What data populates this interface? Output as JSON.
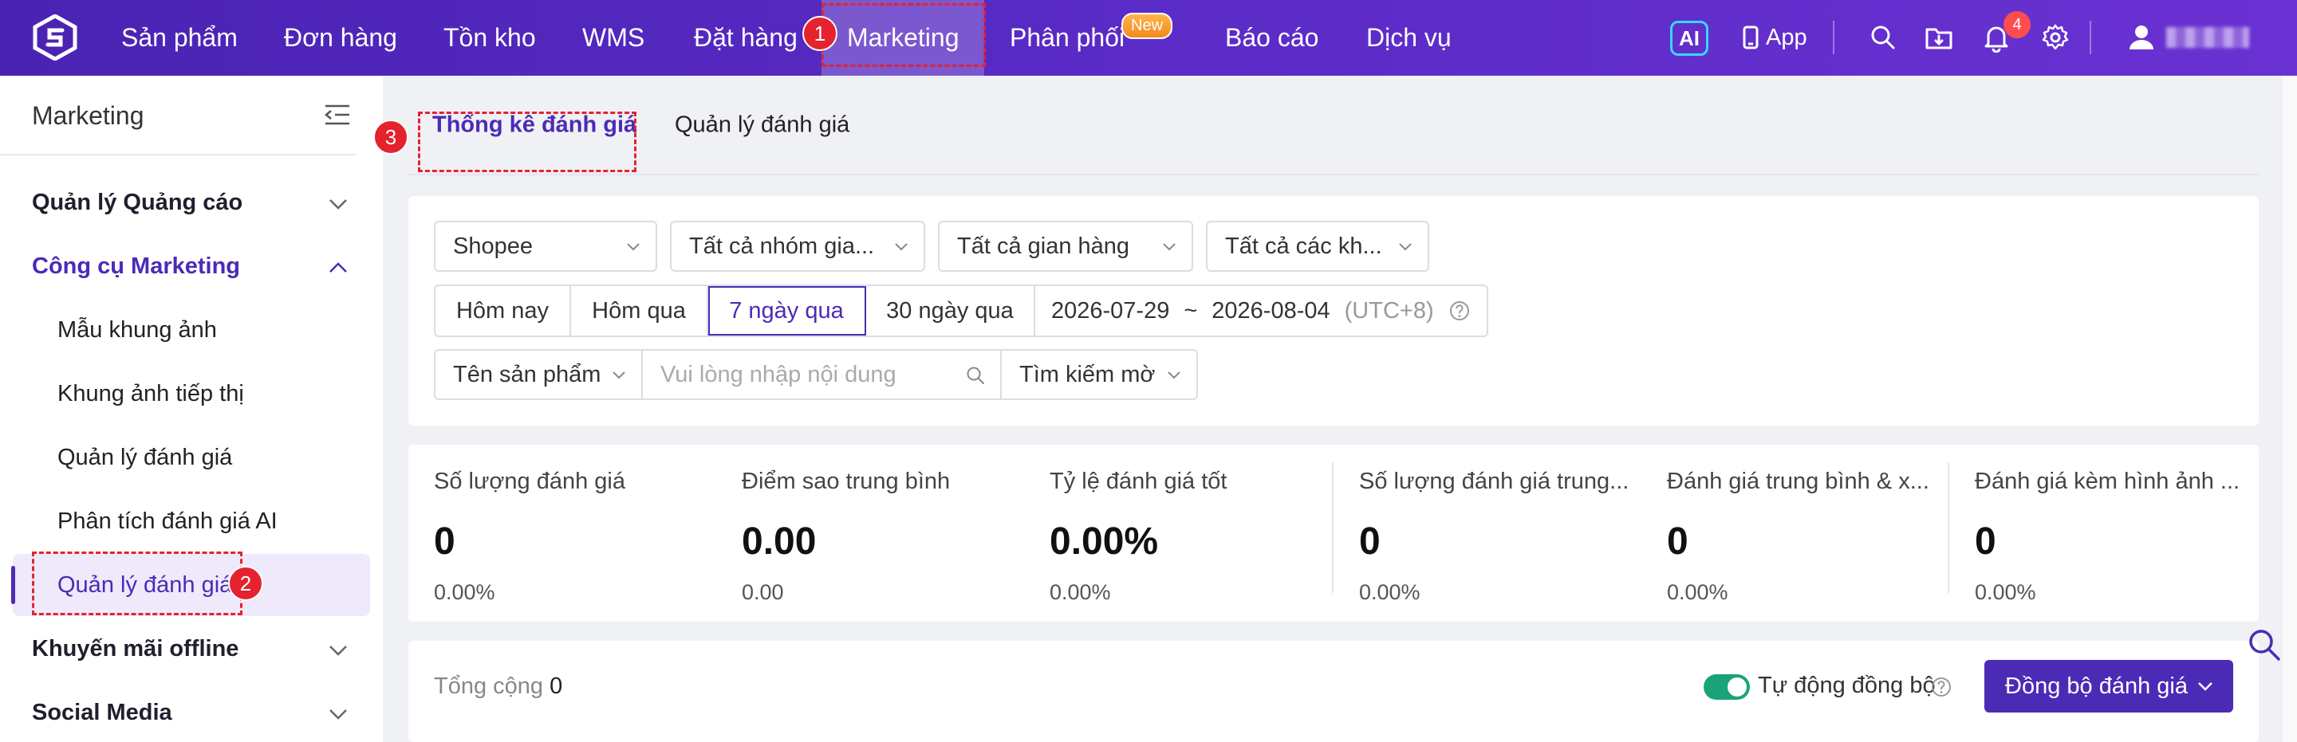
{
  "topnav": {
    "items": [
      {
        "label": "Sản phẩm"
      },
      {
        "label": "Đơn hàng"
      },
      {
        "label": "Tồn kho"
      },
      {
        "label": "WMS"
      },
      {
        "label": "Đặt hàng"
      },
      {
        "label": "Marketing",
        "active": true
      },
      {
        "label": "Phân phối",
        "badge": "New"
      },
      {
        "label": "Báo cáo"
      },
      {
        "label": "Dịch vụ"
      }
    ],
    "ai_label": "AI",
    "app_label": "App",
    "notification_count": "4",
    "annotation_1": "1"
  },
  "sidebar": {
    "title": "Marketing",
    "groups": [
      {
        "label": "Quản lý Quảng cáo"
      },
      {
        "label": "Công cụ Marketing",
        "open": true
      },
      {
        "label": "Khuyến mãi offline"
      },
      {
        "label": "Social Media"
      }
    ],
    "items": [
      {
        "label": "Mẫu khung ảnh"
      },
      {
        "label": "Khung ảnh tiếp thị"
      },
      {
        "label": "Quản lý đánh giá"
      },
      {
        "label": "Phân tích đánh giá AI"
      },
      {
        "label": "Quản lý đánh giá",
        "active": true
      }
    ],
    "annotation_2": "2"
  },
  "tabs": {
    "items": [
      {
        "label": "Thống kê đánh giá",
        "active": true
      },
      {
        "label": "Quản lý đánh giá"
      }
    ],
    "annotation_3": "3"
  },
  "filters": {
    "platform": "Shopee",
    "group": "Tất cả nhóm gia...",
    "store": "Tất cả gian hàng",
    "customer": "Tất cả các kh...",
    "periods": [
      "Hôm nay",
      "Hôm qua",
      "7 ngày qua",
      "30 ngày qua"
    ],
    "active_period": "7 ngày qua",
    "date_start": "2026-07-29",
    "date_sep": "~",
    "date_end": "2026-08-04",
    "timezone": "(UTC+8)",
    "search_field": "Tên sản phẩm",
    "search_placeholder": "Vui lòng nhập nội dung",
    "search_mode": "Tìm kiếm mờ"
  },
  "stats": [
    {
      "label": "Số lượng đánh giá",
      "value": "0",
      "pct": "0.00%"
    },
    {
      "label": "Điểm sao trung bình",
      "value": "0.00",
      "pct": "0.00"
    },
    {
      "label": "Tỷ lệ đánh giá tốt",
      "value": "0.00%",
      "pct": "0.00%"
    },
    {
      "label": "Số lượng đánh giá trung...",
      "value": "0",
      "pct": "0.00%"
    },
    {
      "label": "Đánh giá trung bình & x...",
      "value": "0",
      "pct": "0.00%"
    },
    {
      "label": "Đánh giá kèm hình ảnh ...",
      "value": "0",
      "pct": "0.00%"
    }
  ],
  "list": {
    "total_label": "Tổng cộng",
    "total_value": "0",
    "auto_sync_label": "Tự động đồng bộ",
    "sync_button": "Đồng bộ đánh giá"
  },
  "colors": {
    "brand": "#4b2bb6",
    "nav_gradient_start": "#4a23b3",
    "annotation": "#e4232f",
    "toggle_on": "#1aa37a"
  }
}
